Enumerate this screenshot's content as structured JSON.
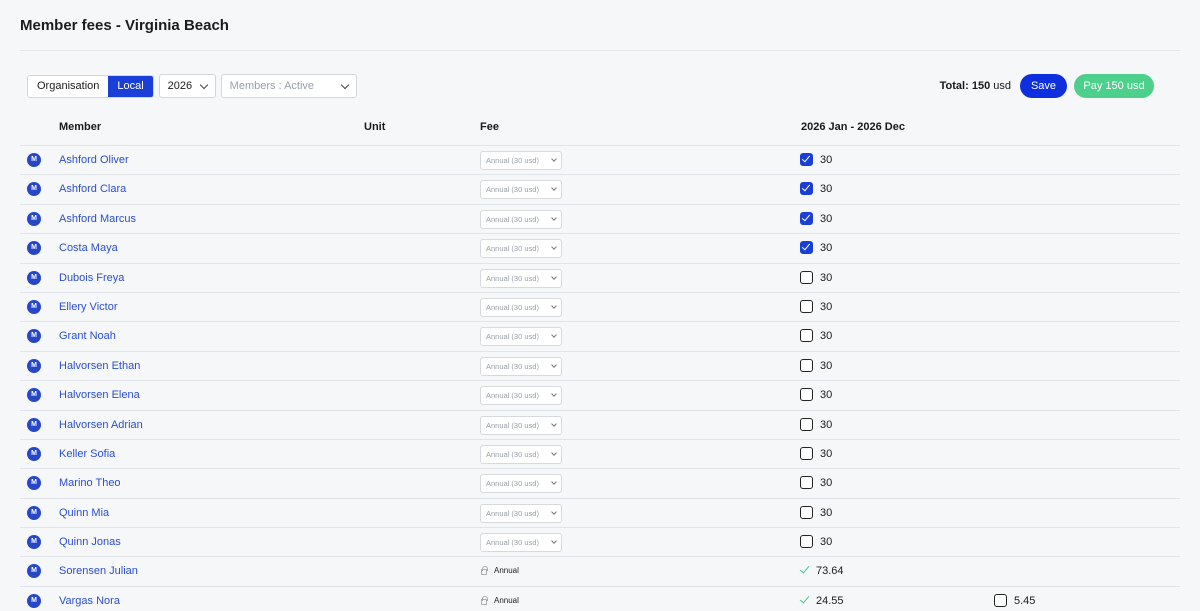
{
  "page": {
    "title": "Member fees - Virginia Beach"
  },
  "toolbar": {
    "scope_options": [
      "Organisation",
      "Local"
    ],
    "active_scope": "Local",
    "year": "2026",
    "members_filter_placeholder": "Members : Active",
    "total_label": "Total:",
    "total_value": "150",
    "total_unit": "usd",
    "save_label": "Save",
    "pay_label": "Pay 150 usd"
  },
  "table": {
    "headers": {
      "member": "Member",
      "unit": "Unit",
      "fee": "Fee",
      "period": "2026 Jan - 2026 Dec"
    },
    "avatar_letter": "M",
    "fee_option": "Annual (30 usd)",
    "rows": [
      {
        "name": "Ashford Oliver",
        "checked": true,
        "amount": "30"
      },
      {
        "name": "Ashford Clara",
        "checked": true,
        "amount": "30"
      },
      {
        "name": "Ashford Marcus",
        "checked": true,
        "amount": "30"
      },
      {
        "name": "Costa Maya",
        "checked": true,
        "amount": "30"
      },
      {
        "name": "Dubois Freya",
        "checked": false,
        "amount": "30"
      },
      {
        "name": "Ellery Victor",
        "checked": false,
        "amount": "30"
      },
      {
        "name": "Grant Noah",
        "checked": false,
        "amount": "30"
      },
      {
        "name": "Halvorsen Ethan",
        "checked": false,
        "amount": "30"
      },
      {
        "name": "Halvorsen Elena",
        "checked": false,
        "amount": "30"
      },
      {
        "name": "Halvorsen Adrian",
        "checked": false,
        "amount": "30"
      },
      {
        "name": "Keller Sofia",
        "checked": false,
        "amount": "30"
      },
      {
        "name": "Marino Theo",
        "checked": false,
        "amount": "30"
      },
      {
        "name": "Quinn Mia",
        "checked": false,
        "amount": "30"
      },
      {
        "name": "Quinn Jonas",
        "checked": false,
        "amount": "30"
      }
    ],
    "locked_rows": [
      {
        "name": "Sorensen Julian",
        "fee": "Annual",
        "paid_amount": "73.64"
      },
      {
        "name": "Vargas Nora",
        "fee": "Annual",
        "paid_amount": "24.55",
        "extra_amount": "5.45"
      }
    ]
  },
  "colors": {
    "accent": "#1a3fd8",
    "pay": "#4cd08c",
    "link": "#2b4fcf",
    "paid_check": "#4cc38a"
  }
}
